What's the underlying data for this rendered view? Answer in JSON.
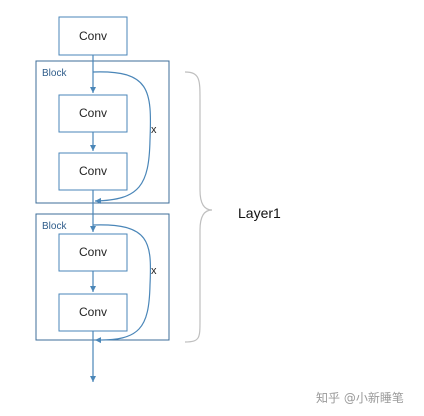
{
  "diagram": {
    "top_conv": "Conv",
    "blocks": [
      {
        "label": "Block",
        "conv1": "Conv",
        "conv2": "Conv",
        "skip_label": "x"
      },
      {
        "label": "Block",
        "conv1": "Conv",
        "conv2": "Conv",
        "skip_label": "x"
      }
    ],
    "group_label": "Layer1",
    "watermark": "知乎 @小新睡笔"
  },
  "colors": {
    "line": "#4a86b8",
    "box_border": "#4a86b8",
    "block_border": "#3c6e99",
    "brace": "#bfbfbf"
  }
}
